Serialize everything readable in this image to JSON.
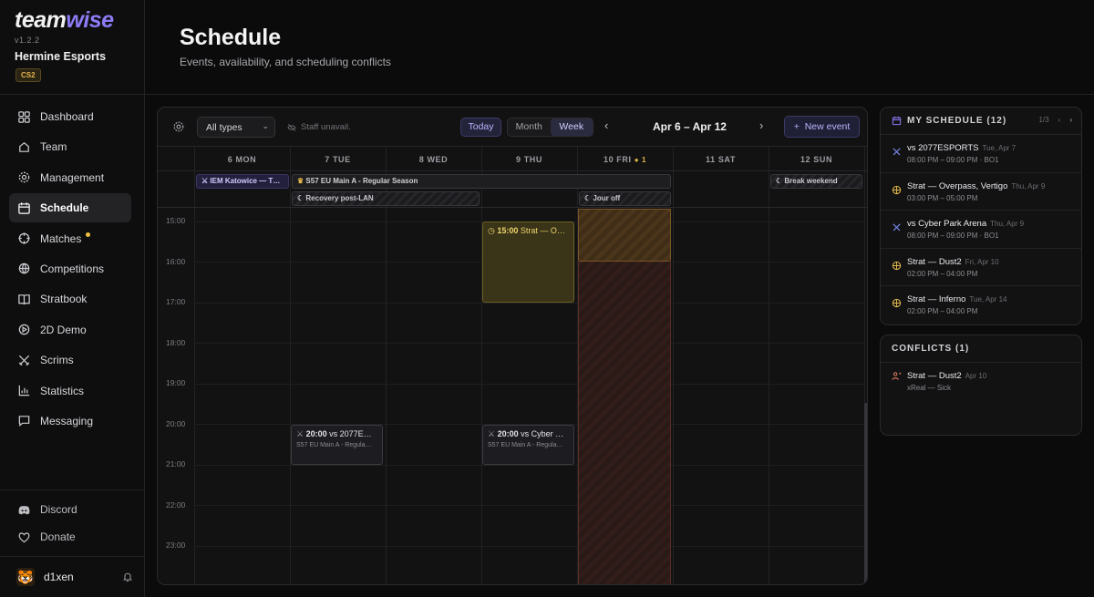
{
  "app": {
    "logo_main": "team",
    "logo_accent": "wise",
    "version": "v1.2.2",
    "team_name": "Hermine Esports",
    "game": "CS2"
  },
  "nav": [
    {
      "label": "Dashboard",
      "icon": "dashboard-icon"
    },
    {
      "label": "Team",
      "icon": "team-icon"
    },
    {
      "label": "Management",
      "icon": "gear-icon"
    },
    {
      "label": "Schedule",
      "icon": "calendar-icon",
      "active": true
    },
    {
      "label": "Matches",
      "icon": "crosshair-icon",
      "badge": true
    },
    {
      "label": "Competitions",
      "icon": "trophy-icon"
    },
    {
      "label": "Stratbook",
      "icon": "book-icon"
    },
    {
      "label": "2D Demo",
      "icon": "demo-icon"
    },
    {
      "label": "Scrims",
      "icon": "swords-icon"
    },
    {
      "label": "Statistics",
      "icon": "chart-icon"
    },
    {
      "label": "Messaging",
      "icon": "message-icon"
    }
  ],
  "footer": {
    "discord": "Discord",
    "donate": "Donate",
    "user": "d1xen"
  },
  "header": {
    "title": "Schedule",
    "subtitle": "Events, availability, and scheduling conflicts"
  },
  "toolbar": {
    "filter": "All types",
    "staff": "Staff unavail.",
    "today": "Today",
    "month": "Month",
    "week": "Week",
    "range": "Apr 6 – Apr 12",
    "new_event": "New event"
  },
  "days": [
    "6 MON",
    "7 TUE",
    "8 WED",
    "9 THU",
    "10 FRI",
    "11 SAT",
    "12 SUN"
  ],
  "friday_conflicts": "1",
  "hours": [
    "15:00",
    "16:00",
    "17:00",
    "18:00",
    "19:00",
    "20:00",
    "21:00",
    "22:00",
    "23:00"
  ],
  "allday": {
    "iem": "IEM Katowice — T…",
    "s57": "S57 EU Main A - Regular Season",
    "recovery": "Recovery post-LAN",
    "jour_off": "Jour off",
    "break": "Break weekend"
  },
  "events": {
    "strat_time": "15:00",
    "strat_title": "Strat — O…",
    "match1_time": "20:00",
    "match1_title": "vs 2077E…",
    "match1_sub": "S57 EU Main A - Regula…",
    "match2_time": "20:00",
    "match2_title": "vs Cyber …",
    "match2_sub": "S57 EU Main A - Regula…"
  },
  "my_schedule": {
    "title": "MY SCHEDULE (12)",
    "pager": "1/3",
    "items": [
      {
        "title": "vs 2077ESPORTS",
        "date": "Tue, Apr 7",
        "time": "08:00 PM – 09:00 PM · BO1",
        "type": "match"
      },
      {
        "title": "Strat — Overpass, Vertigo",
        "date": "Thu, Apr 9",
        "time": "03:00 PM – 05:00 PM",
        "type": "strat"
      },
      {
        "title": "vs Cyber Park Arena",
        "date": "Thu, Apr 9",
        "time": "08:00 PM – 09:00 PM · BO1",
        "type": "match"
      },
      {
        "title": "Strat — Dust2",
        "date": "Fri, Apr 10",
        "time": "02:00 PM – 04:00 PM",
        "type": "strat"
      },
      {
        "title": "Strat — Inferno",
        "date": "Tue, Apr 14",
        "time": "02:00 PM – 04:00 PM",
        "type": "strat"
      }
    ]
  },
  "conflicts": {
    "title": "CONFLICTS (1)",
    "item_title": "Strat — Dust2",
    "item_date": "Apr 10",
    "item_sub": "xReal — Sick"
  },
  "colors": {
    "accent": "#8b7cf6",
    "strat": "#e0b64a",
    "conflict": "#e07a5f"
  }
}
